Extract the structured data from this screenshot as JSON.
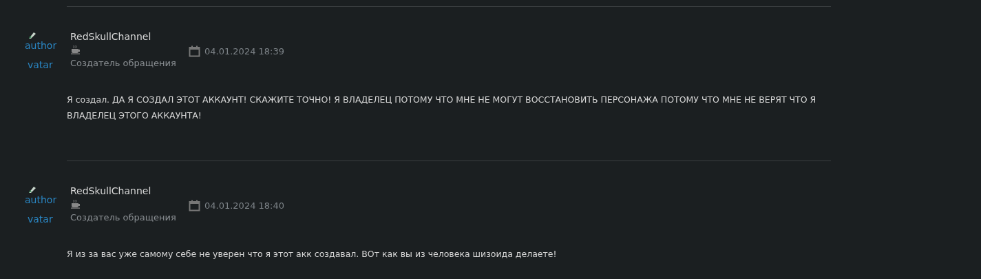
{
  "posts": [
    {
      "avatar": {
        "alt_lines": [
          "author",
          "vatar"
        ]
      },
      "author": "RedSkullChannel",
      "role": "Создатель обращения",
      "date": "04.01.2024 18:39",
      "message": "Я создал. ДА Я СОЗДАЛ ЭТОТ АККАУНТ! СКАЖИТЕ ТОЧНО! Я ВЛАДЕЛЕЦ ПОТОМУ ЧТО МНЕ НЕ МОГУТ ВОССТАНОВИТЬ ПЕРСОНАЖА ПОТОМУ ЧТО МНЕ НЕ ВЕРЯТ ЧТО Я ВЛАДЕЛЕЦ ЭТОГО АККАУНТА!"
    },
    {
      "avatar": {
        "alt_lines": [
          "author",
          "vatar"
        ]
      },
      "author": "RedSkullChannel",
      "role": "Создатель обращения",
      "date": "04.01.2024 18:40",
      "message": "Я из за вас уже самому себе не уверен что я этот акк создавал. ВОт как вы из человека шизоида делаете!"
    }
  ]
}
